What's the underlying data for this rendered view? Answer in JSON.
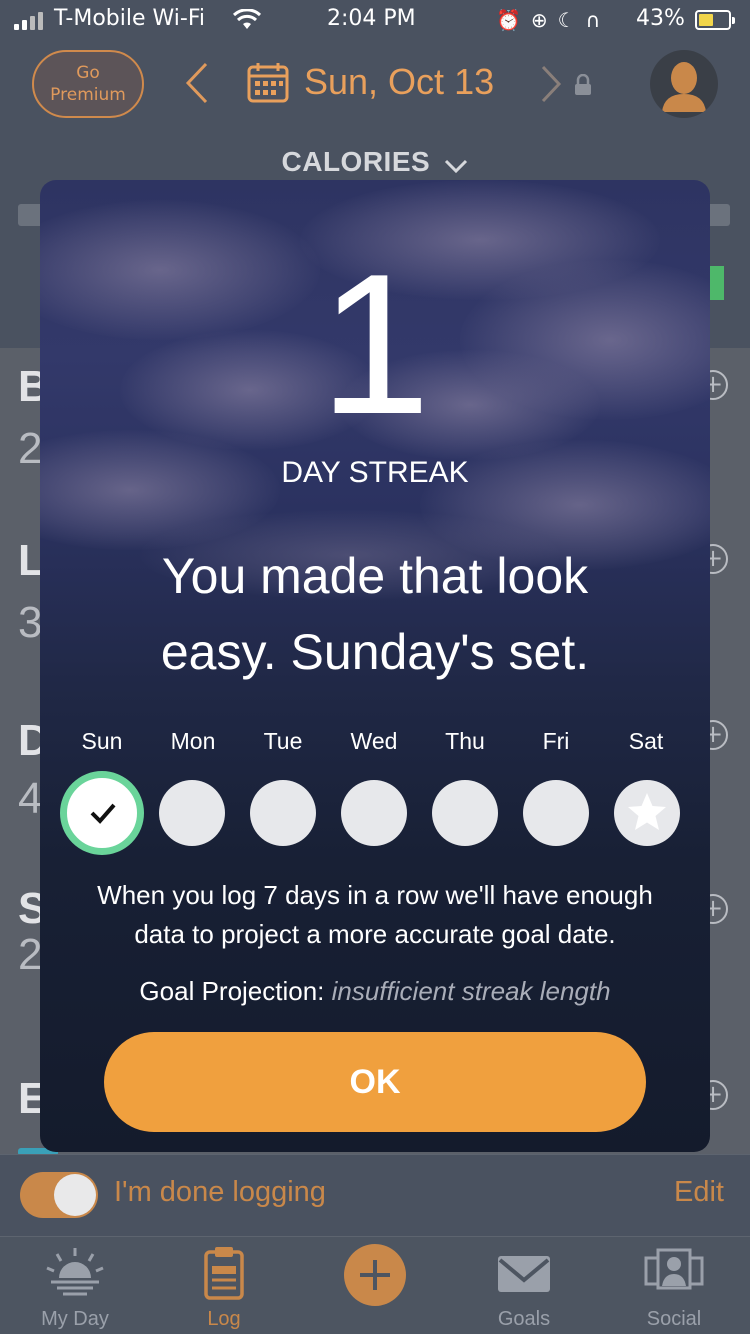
{
  "status_bar": {
    "carrier": "T-Mobile Wi-Fi",
    "time": "2:04 PM",
    "battery_percent": "43%",
    "icons": [
      "signal-icon",
      "wifi-icon",
      "alarm-icon",
      "orientation-lock-icon",
      "moon-icon",
      "headphones-icon",
      "battery-icon"
    ]
  },
  "header": {
    "premium_label_line1": "Go",
    "premium_label_line2": "Premium",
    "date": "Sun, Oct 13",
    "metric_selector": "CALORIES"
  },
  "modal": {
    "streak_count": "1",
    "streak_label": "DAY STREAK",
    "message_line1": "You made that look",
    "message_line2": "easy. Sunday's set.",
    "days": [
      {
        "label": "Sun",
        "state": "done"
      },
      {
        "label": "Mon",
        "state": "empty"
      },
      {
        "label": "Tue",
        "state": "empty"
      },
      {
        "label": "Wed",
        "state": "empty"
      },
      {
        "label": "Thu",
        "state": "empty"
      },
      {
        "label": "Fri",
        "state": "empty"
      },
      {
        "label": "Sat",
        "state": "star"
      }
    ],
    "info_line1": "When you log 7 days in a row we'll have enough",
    "info_line2": "data to project a more accurate goal date.",
    "projection_label": "Goal Projection:",
    "projection_value": "insufficient streak length",
    "ok_label": "OK"
  },
  "footer": {
    "done_logging_label": "I'm done logging",
    "done_logging_on": true,
    "edit_label": "Edit"
  },
  "tabs": [
    {
      "label": "My Day",
      "icon": "sunrise-icon"
    },
    {
      "label": "Log",
      "icon": "clipboard-icon"
    },
    {
      "label": "",
      "icon": "plus-icon"
    },
    {
      "label": "Goals",
      "icon": "envelope-icon"
    },
    {
      "label": "Social",
      "icon": "people-icon"
    }
  ],
  "colors": {
    "accent": "#f0a03e",
    "header_accent": "#e9a05c",
    "streak_green": "#6ad49a"
  }
}
